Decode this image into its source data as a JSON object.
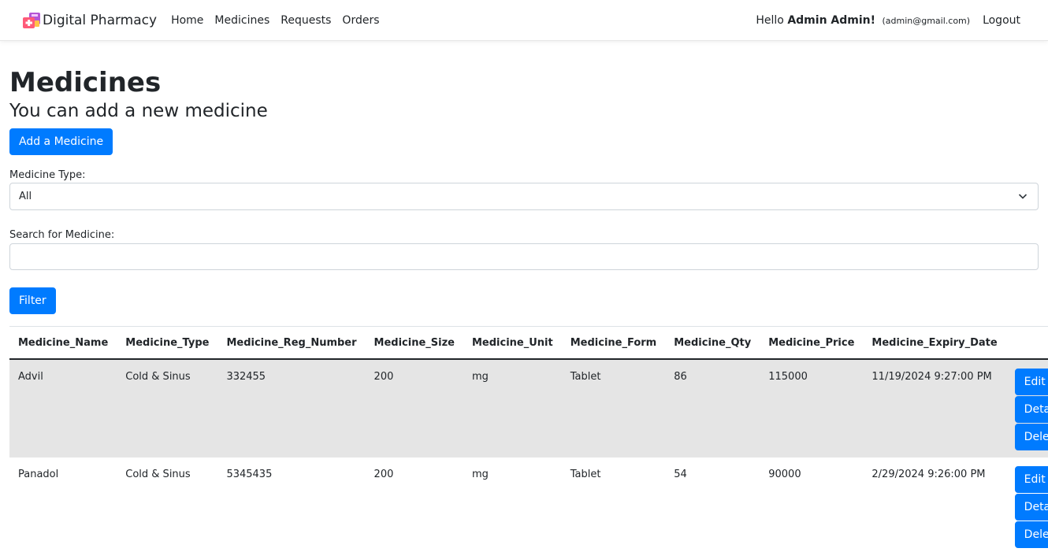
{
  "navbar": {
    "brand": "Digital Pharmacy",
    "links": [
      "Home",
      "Medicines",
      "Requests",
      "Orders"
    ],
    "hello_prefix": "Hello",
    "user_name": "Admin Admin!",
    "user_email": "(admin@gmail.com)",
    "logout": "Logout"
  },
  "page": {
    "title": "Medicines",
    "subtitle": "You can add a new medicine",
    "add_button": "Add a Medicine",
    "type_label": "Medicine Type:",
    "type_selected": "All",
    "search_label": "Search for Medicine:",
    "search_value": "",
    "filter_button": "Filter"
  },
  "table": {
    "headers": [
      "Medicine_Name",
      "Medicine_Type",
      "Medicine_Reg_Number",
      "Medicine_Size",
      "Medicine_Unit",
      "Medicine_Form",
      "Medicine_Qty",
      "Medicine_Price",
      "Medicine_Expiry_Date",
      ""
    ],
    "rows": [
      [
        "Advil",
        "Cold & Sinus",
        "332455",
        "200",
        "mg",
        "Tablet",
        "86",
        "115000",
        "11/19/2024 9:27:00 PM"
      ],
      [
        "Panadol",
        "Cold & Sinus",
        "5345435",
        "200",
        "mg",
        "Tablet",
        "54",
        "90000",
        "2/29/2024 9:26:00 PM"
      ]
    ],
    "actions": [
      "Edit",
      "Details",
      "Delete"
    ]
  },
  "colors": {
    "primary": "#007bff",
    "row_highlight": "#e5e5e5"
  }
}
